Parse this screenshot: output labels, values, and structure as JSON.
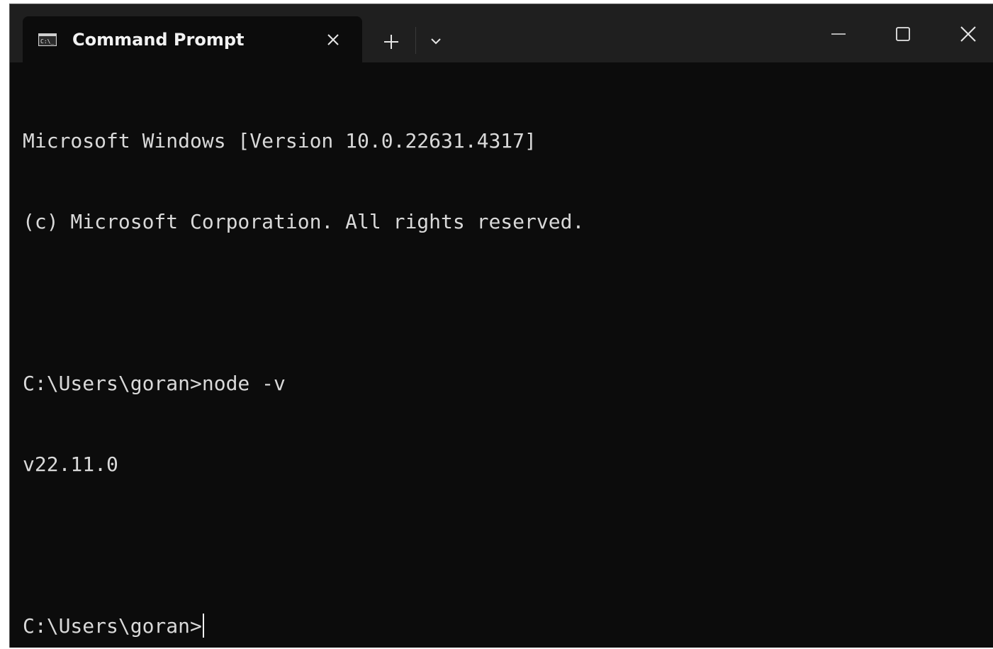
{
  "tab": {
    "title": "Command Prompt",
    "icon": "cmd-icon"
  },
  "toolbar": {
    "new_tab_icon": "plus-icon",
    "dropdown_icon": "chevron-down-icon"
  },
  "window_controls": {
    "minimize_icon": "minimize-icon",
    "maximize_icon": "maximize-icon",
    "close_icon": "close-icon"
  },
  "terminal": {
    "lines": [
      "Microsoft Windows [Version 10.0.22631.4317]",
      "(c) Microsoft Corporation. All rights reserved.",
      "",
      "C:\\Users\\goran>node -v",
      "v22.11.0",
      "",
      "C:\\Users\\goran>"
    ]
  },
  "colors": {
    "background": "#0c0c0c",
    "titlebar": "#1f1f1f",
    "text": "#d9d9d9"
  }
}
